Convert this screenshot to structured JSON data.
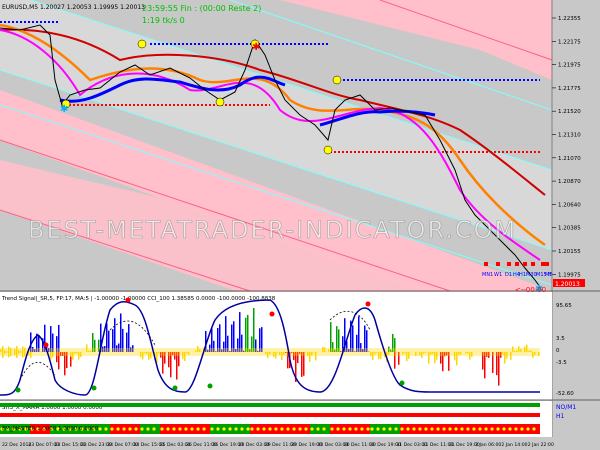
{
  "main_chart": {
    "info_line": "EURUSD,M5  1.20027  1.20053  1.19995  1.20013",
    "timer_text": "23:59:55 Fin : (00:00 Reste 2)",
    "spread_text": "1:19 tk/s 0",
    "watermark": "BEST-METATRADER-INDICATOR.COM",
    "price_ticks": [
      "1.22355",
      "1.22175",
      "1.21975",
      "1.21775",
      "1.21520",
      "1.21310",
      "1.21070",
      "1.20870",
      "1.20640",
      "1.20385",
      "1.20155",
      "1.19975"
    ],
    "current_price": "1.20013",
    "timeframe_labels": [
      "MN1",
      "W1",
      "D1",
      "H4",
      "H1",
      "M30",
      "M15",
      "M5",
      "M1"
    ],
    "countdown": "<--00:00"
  },
  "indicator1": {
    "title": "Trend Signal|_SR,5, FP:17, MA:5 | -1.00000 -1.00000 CCI_100 1.38585 0.0000 -100.0000 -100.8838",
    "ticks": [
      "95.65",
      "3.5",
      "0",
      "-3.5",
      "-52.60"
    ]
  },
  "indicator2": {
    "title": "SH3_X_MAMA 1.0000 1.0000 0.0000",
    "labels": [
      "NO/M1",
      "H1"
    ],
    "ticks": [
      "3.5",
      "0",
      "-3.5"
    ]
  },
  "indicator3": {
    "title": "FM_MASTER 1.0000 1.0000 0.0000"
  },
  "time_axis": [
    "22 Dec 2014",
    "23 Dec 07:00",
    "23 Dec 15:00",
    "23 Dec 23:00",
    "24 Dec 07:00",
    "24 Dec 15:00",
    "25 Dec 03:00",
    "26 Dec 11:00",
    "26 Dec 19:00",
    "29 Dec 03:00",
    "29 Dec 11:00",
    "29 Dec 19:00",
    "30 Dec 03:00",
    "30 Dec 11:00",
    "30 Dec 19:00",
    "31 Dec 03:00",
    "31 Dec 11:00",
    "31 Dec 19:00",
    "2 Jan 06:00",
    "2 Jan 14:00",
    "2 Jan 22:00"
  ],
  "colors": {
    "background": "#c8c8c8",
    "channel_band": "#ffc0cb",
    "channel_line": "#7fffff",
    "trend_blue": "#0000ff",
    "ma_red": "#d00000",
    "ma_orange": "#ff8000",
    "ma_magenta": "#ff00ff",
    "hist_yellow": "#ffd700",
    "hist_red": "#ff0000",
    "hist_green": "#00a000"
  }
}
